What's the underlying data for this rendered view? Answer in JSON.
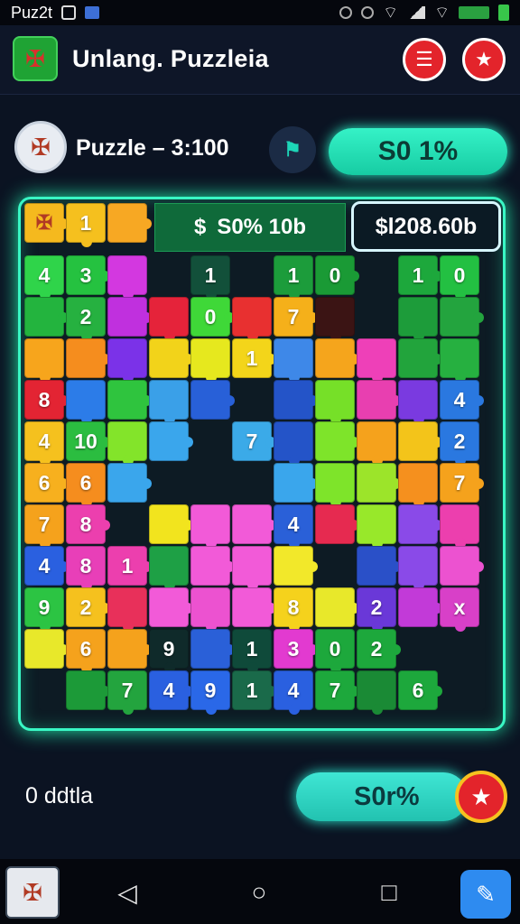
{
  "status_bar": {
    "app_label": "Puz2t"
  },
  "app_bar": {
    "title": "Unlang. Puzzleia"
  },
  "info_bar": {
    "puzzle_label": "Puzzle – 3:100",
    "score": "S0 1%"
  },
  "board": {
    "header_left": "$",
    "header_mid": "S0% 10b",
    "price": "$l208.60b",
    "tiles": [
      {
        "c": "#f5b91e",
        "t": ""
      },
      {
        "c": "#f5c01e",
        "t": "1"
      },
      {
        "c": "#f7a823",
        "t": ""
      },
      null,
      null,
      null,
      null,
      null,
      null,
      null,
      null,
      {
        "c": "#2fd44a",
        "t": "4"
      },
      {
        "c": "#25c240",
        "t": "3"
      },
      {
        "c": "#d338e0",
        "t": ""
      },
      null,
      {
        "c": "#12503a",
        "t": "1"
      },
      null,
      {
        "c": "#1c9c3b",
        "t": "1"
      },
      {
        "c": "#1a9a35",
        "t": "0"
      },
      null,
      {
        "c": "#1da83c",
        "t": "1"
      },
      {
        "c": "#23c042",
        "t": "0"
      },
      {
        "c": "#23b43e",
        "t": ""
      },
      {
        "c": "#26b140",
        "t": "2"
      },
      {
        "c": "#c030de",
        "t": ""
      },
      {
        "c": "#e5233a",
        "t": ""
      },
      {
        "c": "#3fd838",
        "t": "0"
      },
      {
        "c": "#e83030",
        "t": ""
      },
      {
        "c": "#f5b01a",
        "t": "7"
      },
      {
        "c": "#3b1414",
        "t": ""
      },
      null,
      {
        "c": "#1d9c3a",
        "t": ""
      },
      {
        "c": "#23a43e",
        "t": ""
      },
      {
        "c": "#f7a51c",
        "t": ""
      },
      {
        "c": "#f58d1e",
        "t": ""
      },
      {
        "c": "#7b32e8",
        "t": ""
      },
      {
        "c": "#f2d31a",
        "t": ""
      },
      {
        "c": "#e6e81e",
        "t": ""
      },
      {
        "c": "#f3d51a",
        "t": "1"
      },
      {
        "c": "#3e88e8",
        "t": ""
      },
      {
        "c": "#f5a51c",
        "t": ""
      },
      {
        "c": "#ee40b8",
        "t": ""
      },
      {
        "c": "#22a43c",
        "t": ""
      },
      {
        "c": "#26b040",
        "t": ""
      },
      {
        "c": "#e32433",
        "t": "8"
      },
      {
        "c": "#2c7ce8",
        "t": ""
      },
      {
        "c": "#2fc43e",
        "t": ""
      },
      {
        "c": "#3aa0e8",
        "t": ""
      },
      {
        "c": "#2860d8",
        "t": ""
      },
      null,
      {
        "c": "#2454c8",
        "t": ""
      },
      {
        "c": "#76e028",
        "t": ""
      },
      {
        "c": "#e83fb0",
        "t": ""
      },
      {
        "c": "#7a3ae0",
        "t": ""
      },
      {
        "c": "#2a78e0",
        "t": "4"
      },
      {
        "c": "#f5c11e",
        "t": "4"
      },
      {
        "c": "#2bbd40",
        "t": "10"
      },
      {
        "c": "#83e42a",
        "t": ""
      },
      {
        "c": "#3aa6ec",
        "t": ""
      },
      null,
      {
        "c": "#3baae8",
        "t": "7"
      },
      {
        "c": "#2454c8",
        "t": ""
      },
      {
        "c": "#7ee42a",
        "t": ""
      },
      {
        "c": "#f5a21c",
        "t": ""
      },
      {
        "c": "#f3c41a",
        "t": ""
      },
      {
        "c": "#2a78e0",
        "t": "2"
      },
      {
        "c": "#f7b01e",
        "t": "6"
      },
      {
        "c": "#f58d1e",
        "t": "6"
      },
      {
        "c": "#3aa6ec",
        "t": ""
      },
      null,
      null,
      null,
      {
        "c": "#3aa6ec",
        "t": ""
      },
      {
        "c": "#7ee42a",
        "t": ""
      },
      {
        "c": "#9ce42a",
        "t": ""
      },
      {
        "c": "#f5901e",
        "t": ""
      },
      {
        "c": "#f5a21c",
        "t": "7"
      },
      {
        "c": "#f5a21c",
        "t": "7"
      },
      {
        "c": "#ec3fae",
        "t": "8"
      },
      null,
      {
        "c": "#f2e41e",
        "t": ""
      },
      {
        "c": "#f25ad8",
        "t": ""
      },
      {
        "c": "#f25ad8",
        "t": ""
      },
      {
        "c": "#2a60d8",
        "t": "4"
      },
      {
        "c": "#e62a50",
        "t": ""
      },
      {
        "c": "#98e82a",
        "t": ""
      },
      {
        "c": "#8a4ae8",
        "t": ""
      },
      {
        "c": "#ec3fae",
        "t": ""
      },
      {
        "c": "#2a60e0",
        "t": "4"
      },
      {
        "c": "#e83fb8",
        "t": "8"
      },
      {
        "c": "#ec3fae",
        "t": "1"
      },
      {
        "c": "#1ea045",
        "t": ""
      },
      {
        "c": "#f25ad8",
        "t": ""
      },
      {
        "c": "#f25ad8",
        "t": ""
      },
      {
        "c": "#f2e82a",
        "t": ""
      },
      null,
      {
        "c": "#2a50c8",
        "t": ""
      },
      {
        "c": "#8a4ae8",
        "t": ""
      },
      {
        "c": "#ec52d0",
        "t": ""
      },
      {
        "c": "#2cc443",
        "t": "9"
      },
      {
        "c": "#f5c11e",
        "t": "2"
      },
      {
        "c": "#e8305a",
        "t": ""
      },
      {
        "c": "#f25ad8",
        "t": ""
      },
      {
        "c": "#ec52d0",
        "t": ""
      },
      {
        "c": "#f25ad8",
        "t": ""
      },
      {
        "c": "#f5d21c",
        "t": "8"
      },
      {
        "c": "#e8e82a",
        "t": ""
      },
      {
        "c": "#6a38d8",
        "t": "2"
      },
      {
        "c": "#c23ad8",
        "t": ""
      },
      {
        "c": "#d840c8",
        "t": "x"
      },
      {
        "c": "#e8e82a",
        "t": ""
      },
      {
        "c": "#f5a21c",
        "t": "6"
      },
      {
        "c": "#f5a21c",
        "t": ""
      },
      {
        "c": "#0f2a2a",
        "t": "9"
      },
      {
        "c": "#2a60d8",
        "t": ""
      },
      {
        "c": "#0f4a3a",
        "t": "1"
      },
      {
        "c": "#e23ad0",
        "t": "3"
      },
      {
        "c": "#1da83c",
        "t": "0"
      },
      {
        "c": "#1da83c",
        "t": "2"
      },
      null,
      null,
      null,
      {
        "c": "#1c9a38",
        "t": ""
      },
      {
        "c": "#23a43e",
        "t": "7"
      },
      {
        "c": "#2a60e0",
        "t": "4"
      },
      {
        "c": "#2a68e8",
        "t": "9"
      },
      {
        "c": "#1a6a4a",
        "t": "1"
      },
      {
        "c": "#2a60e0",
        "t": "4"
      },
      {
        "c": "#1da83c",
        "t": "7"
      },
      {
        "c": "#1a8a35",
        "t": ""
      },
      {
        "c": "#1da83c",
        "t": "6"
      },
      null
    ]
  },
  "bottom": {
    "label": "0 ddtla",
    "pill": "S0r%"
  },
  "colors": {
    "accent": "#39f7c4",
    "danger": "#e3242b",
    "gold": "#f6c21f"
  }
}
